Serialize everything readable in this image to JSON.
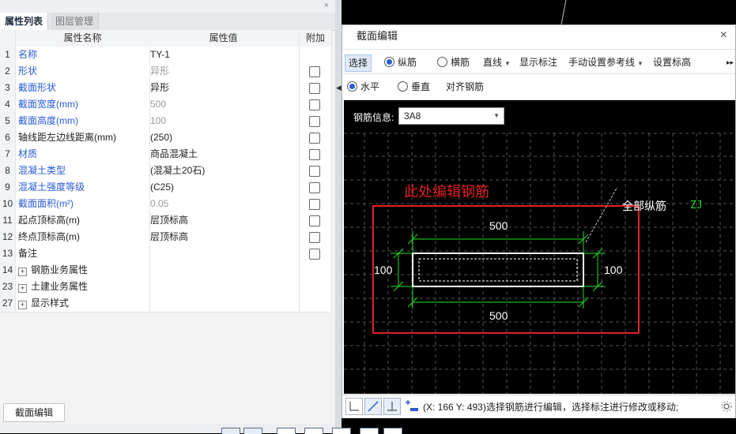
{
  "left_panel": {
    "tabs": [
      {
        "label": "属性列表"
      },
      {
        "label": "图层管理"
      }
    ],
    "close": "×",
    "header": {
      "no": "",
      "name": "属性名称",
      "value": "属性值",
      "extra": "附加"
    },
    "rows": [
      {
        "no": "1",
        "name": "名称",
        "value": "TY-1",
        "name_color": "blue",
        "value_gray": false,
        "checkbox": false
      },
      {
        "no": "2",
        "name": "形状",
        "value": "异形",
        "name_color": "blue",
        "value_gray": true,
        "checkbox": true
      },
      {
        "no": "3",
        "name": "截面形状",
        "value": "异形",
        "name_color": "blue",
        "value_gray": false,
        "checkbox": true
      },
      {
        "no": "4",
        "name": "截面宽度(mm)",
        "value": "500",
        "name_color": "blue",
        "value_gray": true,
        "checkbox": true
      },
      {
        "no": "5",
        "name": "截面高度(mm)",
        "value": "100",
        "name_color": "blue",
        "value_gray": true,
        "checkbox": true
      },
      {
        "no": "6",
        "name": "轴线距左边线距离(mm)",
        "value": "(250)",
        "name_color": "black",
        "value_gray": false,
        "checkbox": true
      },
      {
        "no": "7",
        "name": "材质",
        "value": "商品混凝土",
        "name_color": "blue",
        "value_gray": false,
        "checkbox": true
      },
      {
        "no": "8",
        "name": "混凝土类型",
        "value": "(混凝土20石)",
        "name_color": "blue",
        "value_gray": false,
        "checkbox": true
      },
      {
        "no": "9",
        "name": "混凝土强度等级",
        "value": "(C25)",
        "name_color": "blue",
        "value_gray": false,
        "checkbox": true
      },
      {
        "no": "10",
        "name": "截面面积(m²)",
        "value": "0.05",
        "name_color": "blue",
        "value_gray": true,
        "checkbox": true
      },
      {
        "no": "11",
        "name": "起点顶标高(m)",
        "value": "层顶标高",
        "name_color": "black",
        "value_gray": false,
        "checkbox": true
      },
      {
        "no": "12",
        "name": "终点顶标高(m)",
        "value": "层顶标高",
        "name_color": "black",
        "value_gray": false,
        "checkbox": true
      },
      {
        "no": "13",
        "name": "备注",
        "value": "",
        "name_color": "black",
        "value_gray": false,
        "checkbox": true
      },
      {
        "no": "14",
        "name": "钢筋业务属性",
        "value": "",
        "name_color": "black",
        "value_gray": false,
        "checkbox": false,
        "expand": "+"
      },
      {
        "no": "23",
        "name": "土建业务属性",
        "value": "",
        "name_color": "black",
        "value_gray": false,
        "checkbox": false,
        "expand": "+"
      },
      {
        "no": "27",
        "name": "显示样式",
        "value": "",
        "name_color": "black",
        "value_gray": false,
        "checkbox": false,
        "expand": "+"
      }
    ],
    "bottom_button": "截面编辑"
  },
  "dialog": {
    "title": "截面编辑",
    "close": "×",
    "toolbar1": {
      "select": "选择",
      "longitudinal": "纵筋",
      "transverse": "横筋",
      "line": "直线",
      "show_dim": "显示标注",
      "manual_ref": "手动设置参考线",
      "set_elev": "设置标高",
      "more": "▸▸"
    },
    "toolbar2": {
      "horizontal": "水平",
      "vertical": "垂直",
      "align": "对齐钢筋"
    },
    "rebar_info_label": "钢筋信息:",
    "rebar_info_value": "3A8",
    "annotation_red": "此处编辑钢筋",
    "label_all": "全部纵筋",
    "label_zj": "ZJ",
    "dims": {
      "top": "500",
      "bottom": "500",
      "left": "100",
      "right": "100"
    },
    "status_text": "(X: 166 Y: 493)选择钢筋进行编辑，选择标注进行修改或移动;"
  },
  "colors": {
    "accent_blue": "#2a5bd7",
    "dim_green": "#22dd22",
    "annotation_red": "#e02020",
    "grid": "#555555"
  }
}
